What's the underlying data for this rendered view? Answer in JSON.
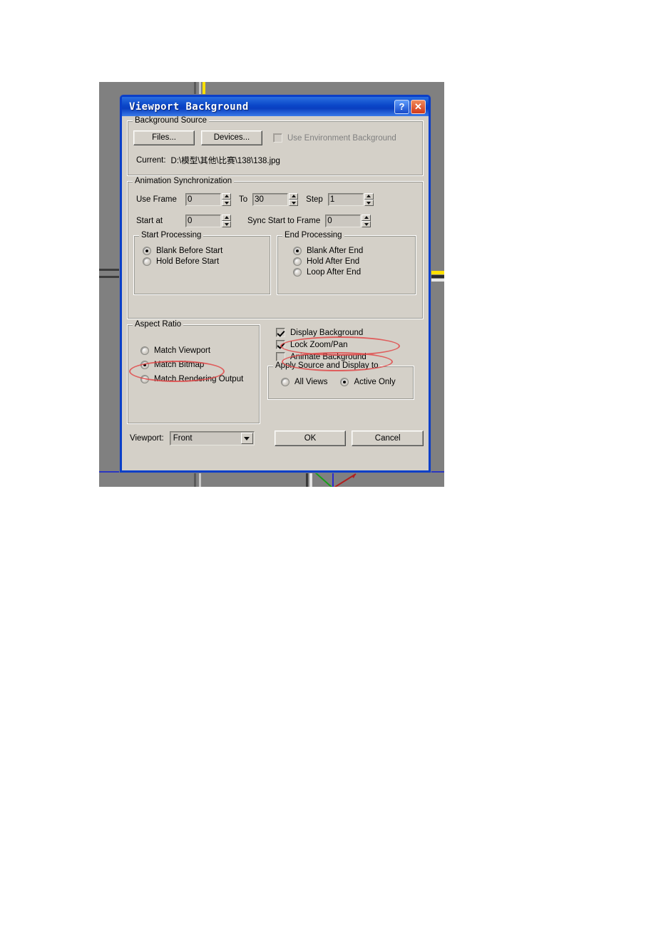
{
  "dialog": {
    "title": "Viewport Background",
    "titlebar_buttons": [
      {
        "name": "help-button",
        "label": "?"
      },
      {
        "name": "close-button",
        "label": "✕"
      }
    ],
    "background_source": {
      "legend": "Background Source",
      "files_button": "Files...",
      "devices_button": "Devices...",
      "use_environment_background": {
        "label": "Use Environment Background",
        "checked": false,
        "enabled": false
      },
      "current_label": "Current:",
      "current_path": "D:\\模型\\其他\\比赛\\138\\138.jpg"
    },
    "animation_sync": {
      "legend": "Animation Synchronization",
      "use_frame_label": "Use Frame",
      "use_frame_value": "0",
      "to_label": "To",
      "to_value": "30",
      "step_label": "Step",
      "step_value": "1",
      "start_at_label": "Start at",
      "start_at_value": "0",
      "sync_start_label": "Sync Start to Frame",
      "sync_start_value": "0",
      "start_processing": {
        "legend": "Start Processing",
        "options": [
          {
            "label": "Blank Before Start",
            "selected": true
          },
          {
            "label": "Hold Before Start",
            "selected": false
          }
        ]
      },
      "end_processing": {
        "legend": "End Processing",
        "options": [
          {
            "label": "Blank After End",
            "selected": true
          },
          {
            "label": "Hold After End",
            "selected": false
          },
          {
            "label": "Loop After End",
            "selected": false
          }
        ]
      }
    },
    "aspect_ratio": {
      "legend": "Aspect Ratio",
      "options": [
        {
          "label": "Match Viewport",
          "selected": false
        },
        {
          "label": "Match Bitmap",
          "selected": true,
          "annotated": true
        },
        {
          "label": "Match Rendering Output",
          "selected": false
        }
      ]
    },
    "display_options": [
      {
        "label": "Display Background",
        "checked": true,
        "annotated": true
      },
      {
        "label": "Lock Zoom/Pan",
        "checked": true,
        "annotated": true
      },
      {
        "label": "Animate Background",
        "checked": false,
        "annotated": false
      }
    ],
    "apply_to": {
      "legend": "Apply Source and Display to",
      "options": [
        {
          "label": "All Views",
          "selected": false
        },
        {
          "label": "Active Only",
          "selected": true
        }
      ]
    },
    "footer": {
      "viewport_label": "Viewport:",
      "viewport_value": "Front",
      "ok_button": "OK",
      "cancel_button": "Cancel"
    }
  },
  "colors": {
    "title_bar": "#0a46c8",
    "dialog_face": "#d4d0c8",
    "viewport_bg": "#808080",
    "annotation": "#e04a4a",
    "close_button": "#d2391a"
  }
}
